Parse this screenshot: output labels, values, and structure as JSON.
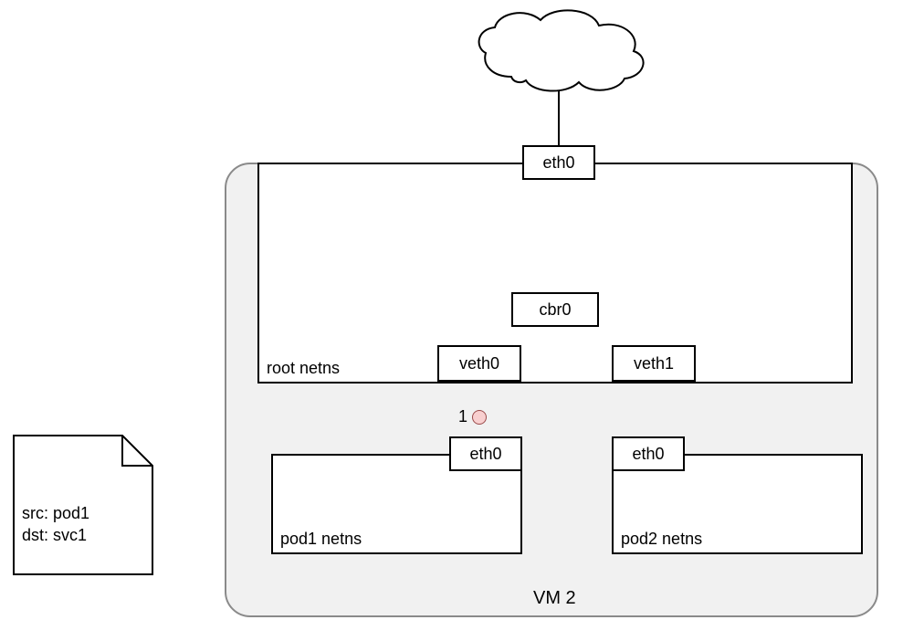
{
  "cloud": {
    "label": ""
  },
  "vm": {
    "title": "VM 2",
    "root_netns": {
      "label": "root netns",
      "eth0": "eth0",
      "cbr0": "cbr0",
      "veth0": "veth0",
      "veth1": "veth1"
    },
    "pod1_netns": {
      "label": "pod1 netns",
      "eth0": "eth0"
    },
    "pod2_netns": {
      "label": "pod2 netns",
      "eth0": "eth0"
    },
    "marker": {
      "index": "1"
    }
  },
  "note": {
    "src_line": "src: pod1",
    "dst_line": "dst: svc1"
  }
}
